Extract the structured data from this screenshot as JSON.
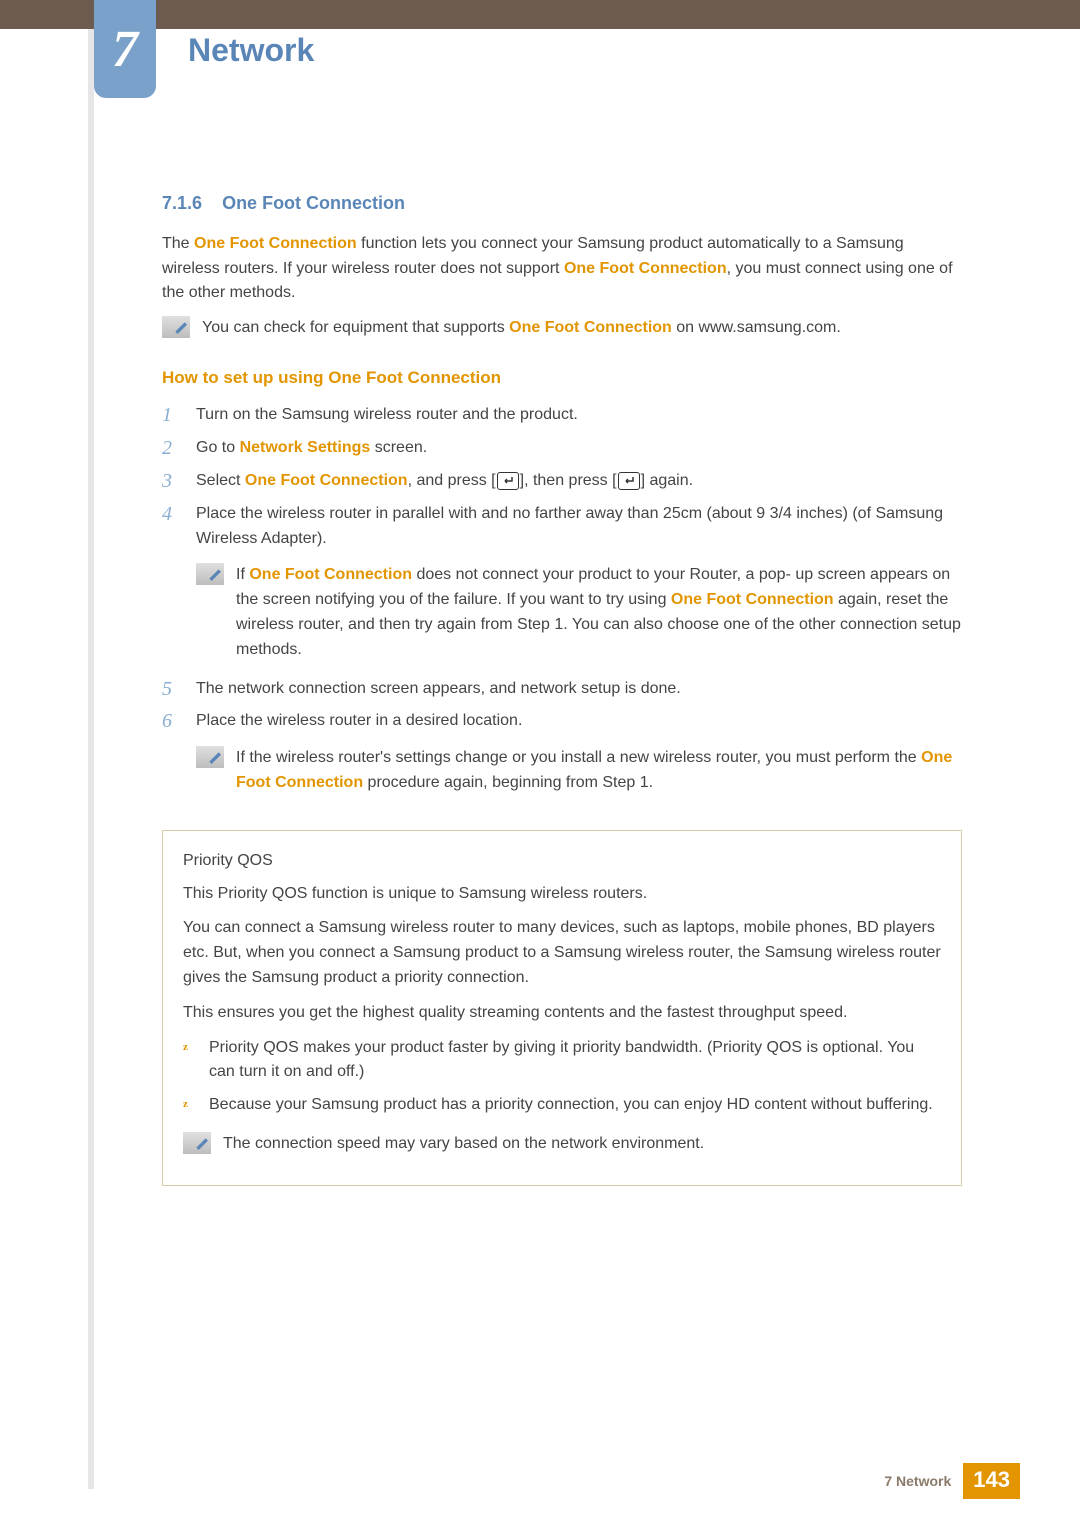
{
  "chapter": {
    "number": "7",
    "title": "Network"
  },
  "section": {
    "number": "7.1.6",
    "title": "One Foot Connection"
  },
  "intro": {
    "t1a": "The ",
    "hl1": "One Foot Connection",
    "t1b": " function lets you connect your Samsung product automatically to a Samsung wireless routers. If your wireless router does not support ",
    "hl2": "One Foot Connection",
    "t1c": ", you must connect using one of the other methods."
  },
  "note1": {
    "a": "You can check for equipment that supports ",
    "hl": "One Foot Connection",
    "b": " on www.samsung.com."
  },
  "subheading": "How to set up using One Foot Connection",
  "steps": {
    "s1": {
      "num": "1",
      "text": "Turn on the Samsung wireless router and the product."
    },
    "s2": {
      "num": "2",
      "a": "Go to ",
      "hl": "Network Settings",
      "b": " screen."
    },
    "s3": {
      "num": "3",
      "a": "Select ",
      "hl": "One Foot Connection",
      "b": ", and press [",
      "c": "], then press [",
      "d": "] again."
    },
    "s4": {
      "num": "4",
      "text": "Place the wireless router in parallel with and no farther away than 25cm (about 9 3/4 inches) (of Samsung Wireless Adapter)."
    },
    "s4note": {
      "a": "If ",
      "hl1": "One Foot Connection",
      "b": " does not connect your product to your Router, a pop- up screen appears on the screen notifying you of the failure. If you want to try using ",
      "hl2": "One Foot Connection",
      "c": " again, reset the wireless router, and then try again from Step 1. You can also choose one of the other connection setup methods."
    },
    "s5": {
      "num": "5",
      "text": "The network connection screen appears, and network setup is done."
    },
    "s6": {
      "num": "6",
      "text": "Place the wireless router in a desired location."
    },
    "s6note": {
      "a": "If the wireless router's settings change or you install a new wireless router, you must perform the ",
      "hl": "One Foot Connection",
      "b": " procedure again, beginning from Step 1."
    }
  },
  "qos": {
    "title": "Priority QOS",
    "p1": "This Priority QOS function is unique to Samsung wireless routers.",
    "p2": "You can connect a Samsung wireless router to many devices, such as laptops, mobile phones, BD players etc. But, when you connect a Samsung product to a Samsung wireless router, the Samsung wireless router gives the Samsung product a priority connection.",
    "p3": "This ensures you get the highest quality streaming contents and the fastest throughput speed.",
    "b1": "Priority QOS makes your product faster by giving it priority bandwidth. (Priority QOS is optional. You can turn it on and off.)",
    "b2": "Because your Samsung product has a priority connection, you can enjoy HD content without buffering.",
    "note": "The connection speed may vary based on the network environment.",
    "bullet": "z"
  },
  "footer": {
    "label": "7 Network",
    "page": "143"
  }
}
